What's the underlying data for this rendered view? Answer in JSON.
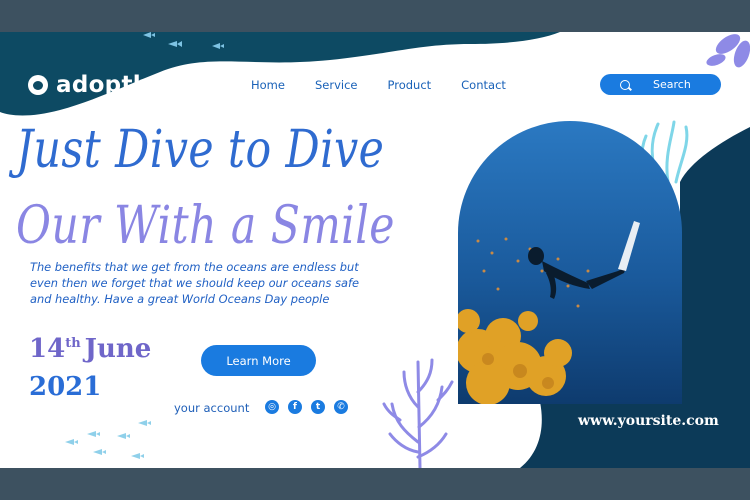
{
  "brand": {
    "name": "adopth"
  },
  "nav": [
    {
      "label": "Home"
    },
    {
      "label": "Service"
    },
    {
      "label": "Product"
    },
    {
      "label": "Contact"
    }
  ],
  "search": {
    "label": "Search"
  },
  "hero": {
    "line1": "Just Dive to Dive",
    "line2": "Our With a Smile",
    "description": "The benefits that we get from the oceans are endless but even then we forget that we should keep our oceans safe and healthy. Have a great World Oceans Day people"
  },
  "event": {
    "day": "14",
    "suffix": "th",
    "month": "June",
    "year": "2021"
  },
  "cta": {
    "label": "Learn More"
  },
  "account": {
    "label": "your account"
  },
  "social": [
    {
      "icon": "instagram-icon",
      "glyph": "◎"
    },
    {
      "icon": "facebook-icon",
      "glyph": "f"
    },
    {
      "icon": "twitter-icon",
      "glyph": "t"
    },
    {
      "icon": "whatsapp-icon",
      "glyph": "✆"
    }
  ],
  "website": "www.yoursite.com",
  "colors": {
    "frame": "#3d5160",
    "deep_teal": "#0d4a63",
    "navy": "#0c3a58",
    "accent_blue": "#1a7be0",
    "heading_blue": "#2f6bd0",
    "heading_violet": "#8a86e3",
    "coral": "#8e8ae6"
  }
}
